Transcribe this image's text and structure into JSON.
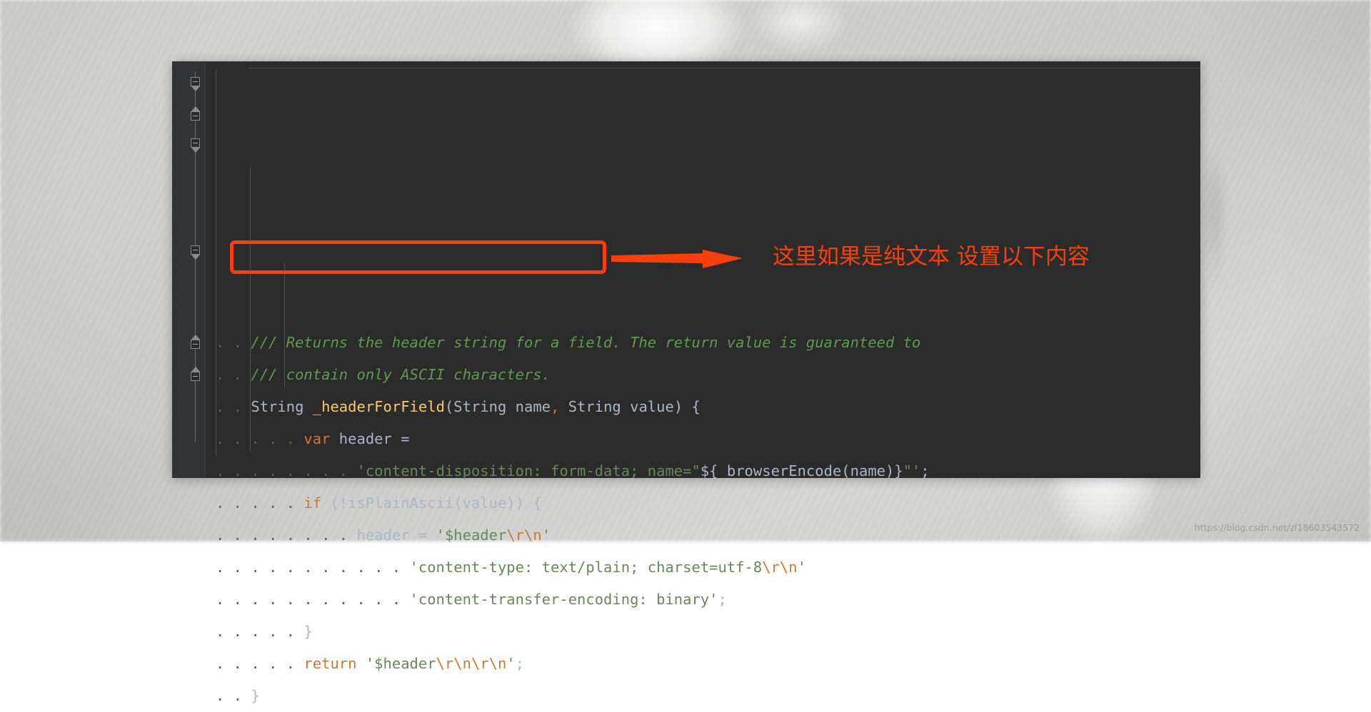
{
  "editor": {
    "theme_background": "#2b2b2b",
    "gutter_background": "#313335",
    "language": "dart",
    "lines": [
      {
        "indent_dots": "..",
        "tokens": [
          {
            "t": "/// Returns the header string for a field. The return value is guaranteed to",
            "c": "doc"
          }
        ]
      },
      {
        "indent_dots": "..",
        "tokens": [
          {
            "t": "/// contain only ASCII characters.",
            "c": "doc"
          }
        ]
      },
      {
        "indent_dots": "..",
        "tokens": [
          {
            "t": "String ",
            "c": "type"
          },
          {
            "t": "_headerForField",
            "c": "fn"
          },
          {
            "t": "(",
            "c": "punct"
          },
          {
            "t": "String name",
            "c": "type"
          },
          {
            "t": ",",
            "c": "kw"
          },
          {
            "t": " String value",
            "c": "type"
          },
          {
            "t": ") {",
            "c": "punct"
          }
        ]
      },
      {
        "indent_dots": ".....",
        "tokens": [
          {
            "t": "var ",
            "c": "kw"
          },
          {
            "t": "header =",
            "c": "plain"
          }
        ]
      },
      {
        "indent_dots": "........",
        "tokens": [
          {
            "t": "'content-disposition: form-data; name=\"",
            "c": "str"
          },
          {
            "t": "${_browserEncode(name)}",
            "c": "plain"
          },
          {
            "t": "\"'",
            "c": "str"
          },
          {
            "t": ";",
            "c": "punct"
          }
        ]
      },
      {
        "indent_dots": ".....",
        "tokens": [
          {
            "t": "if ",
            "c": "kw"
          },
          {
            "t": "(!isPlainAscii(value)) {",
            "c": "plain"
          }
        ]
      },
      {
        "indent_dots": "........",
        "tokens": [
          {
            "t": "header = ",
            "c": "plain"
          },
          {
            "t": "'$header",
            "c": "str"
          },
          {
            "t": "\\r\\n",
            "c": "esc"
          },
          {
            "t": "'",
            "c": "str"
          }
        ]
      },
      {
        "indent_dots": "...........",
        "tokens": [
          {
            "t": "'content-type: text/plain; charset=utf-8",
            "c": "str"
          },
          {
            "t": "\\r\\n",
            "c": "esc"
          },
          {
            "t": "'",
            "c": "str"
          }
        ]
      },
      {
        "indent_dots": "...........",
        "tokens": [
          {
            "t": "'content-transfer-encoding: binary'",
            "c": "str"
          },
          {
            "t": ";",
            "c": "punct"
          }
        ]
      },
      {
        "indent_dots": ".....",
        "tokens": [
          {
            "t": "}",
            "c": "plain"
          }
        ]
      },
      {
        "indent_dots": ".....",
        "tokens": [
          {
            "t": "return ",
            "c": "kw"
          },
          {
            "t": "'$header",
            "c": "str"
          },
          {
            "t": "\\r\\n\\r\\n",
            "c": "esc"
          },
          {
            "t": "'",
            "c": "str"
          },
          {
            "t": ";",
            "c": "punct"
          }
        ]
      },
      {
        "indent_dots": "..",
        "tokens": [
          {
            "t": "}",
            "c": "plain"
          }
        ]
      }
    ]
  },
  "annotation": {
    "color": "#f9400c",
    "highlight_target": "if (!isPlainAscii(value)) {",
    "arrow_direction": "right",
    "text": "这里如果是纯文本 设置以下内容"
  },
  "watermark": {
    "text": "https://blog.csdn.net/zl18603543572"
  }
}
